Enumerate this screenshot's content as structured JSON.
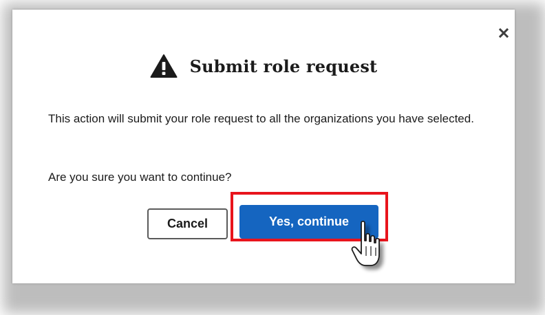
{
  "dialog": {
    "title": "Submit role request",
    "title_icon": "warning-triangle-icon",
    "close_icon": "close-icon",
    "body": "This action will submit your role request to all the organizations you have selected.",
    "question": "Are you sure you want to continue?",
    "cancel_label": "Cancel",
    "confirm_label": "Yes, continue"
  },
  "annotation": {
    "highlight_color": "#e8141c",
    "cursor_icon": "hand-pointer-icon"
  },
  "colors": {
    "primary_button": "#1565c0",
    "text": "#1b1b1b",
    "cancel_border": "#5a5a5a"
  }
}
